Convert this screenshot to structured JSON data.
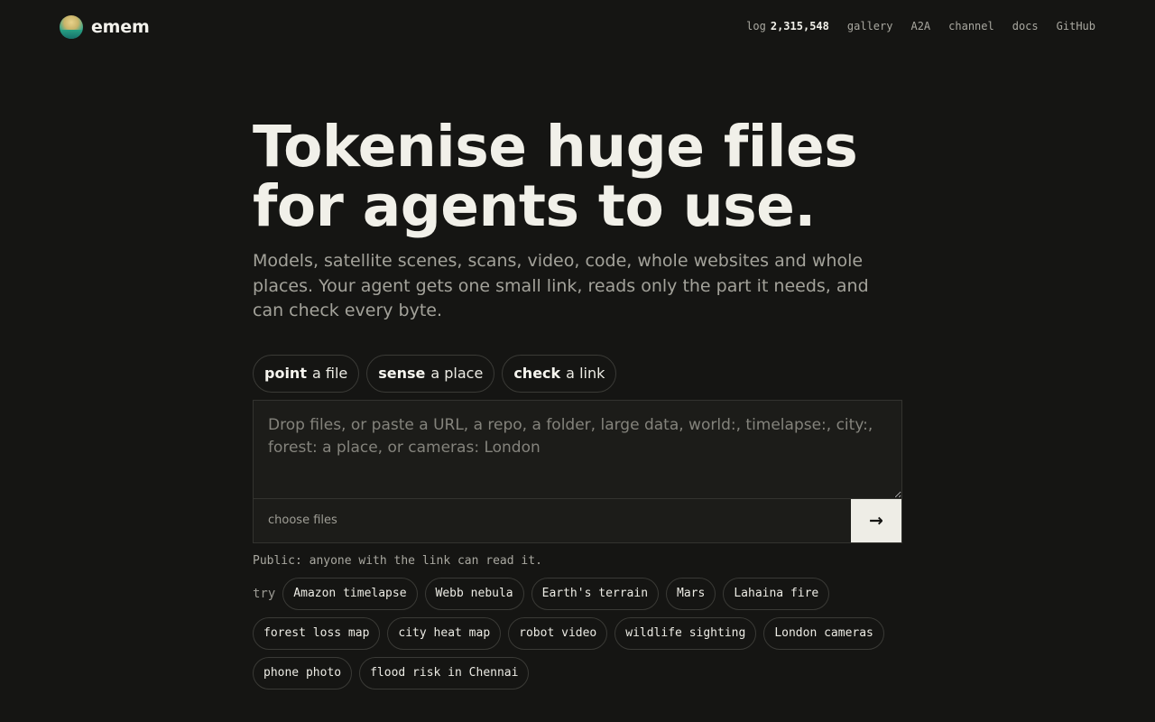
{
  "brand": {
    "name": "emem",
    "logo_icon": "globe-logo-icon"
  },
  "nav": {
    "log_label": "log",
    "log_count": "2,315,548",
    "links": [
      "gallery",
      "A2A",
      "channel",
      "docs",
      "GitHub"
    ]
  },
  "hero": {
    "title_line1": "Tokenise huge files",
    "title_line2": "for agents to use.",
    "subtitle": "Models, satellite scenes, scans, video, code, whole websites and whole places. Your agent gets one small link, reads only the part it needs, and can check every byte."
  },
  "modes": [
    {
      "bold": "point",
      "rest": "a file"
    },
    {
      "bold": "sense",
      "rest": "a place"
    },
    {
      "bold": "check",
      "rest": "a link"
    }
  ],
  "input": {
    "placeholder": "Drop files, or paste a URL, a repo, a folder, large data, world:, timelapse:, city:, forest: a place, or cameras: London",
    "value": "",
    "choose_label": "choose files",
    "submit_glyph": "→"
  },
  "public_note": "Public: anyone with the link can read it.",
  "try": {
    "label": "try",
    "chips": [
      "Amazon timelapse",
      "Webb nebula",
      "Earth's terrain",
      "Mars",
      "Lahaina fire",
      "forest loss map",
      "city heat map",
      "robot video",
      "wildlife sighting",
      "London cameras",
      "phone photo",
      "flood risk in Chennai"
    ]
  }
}
